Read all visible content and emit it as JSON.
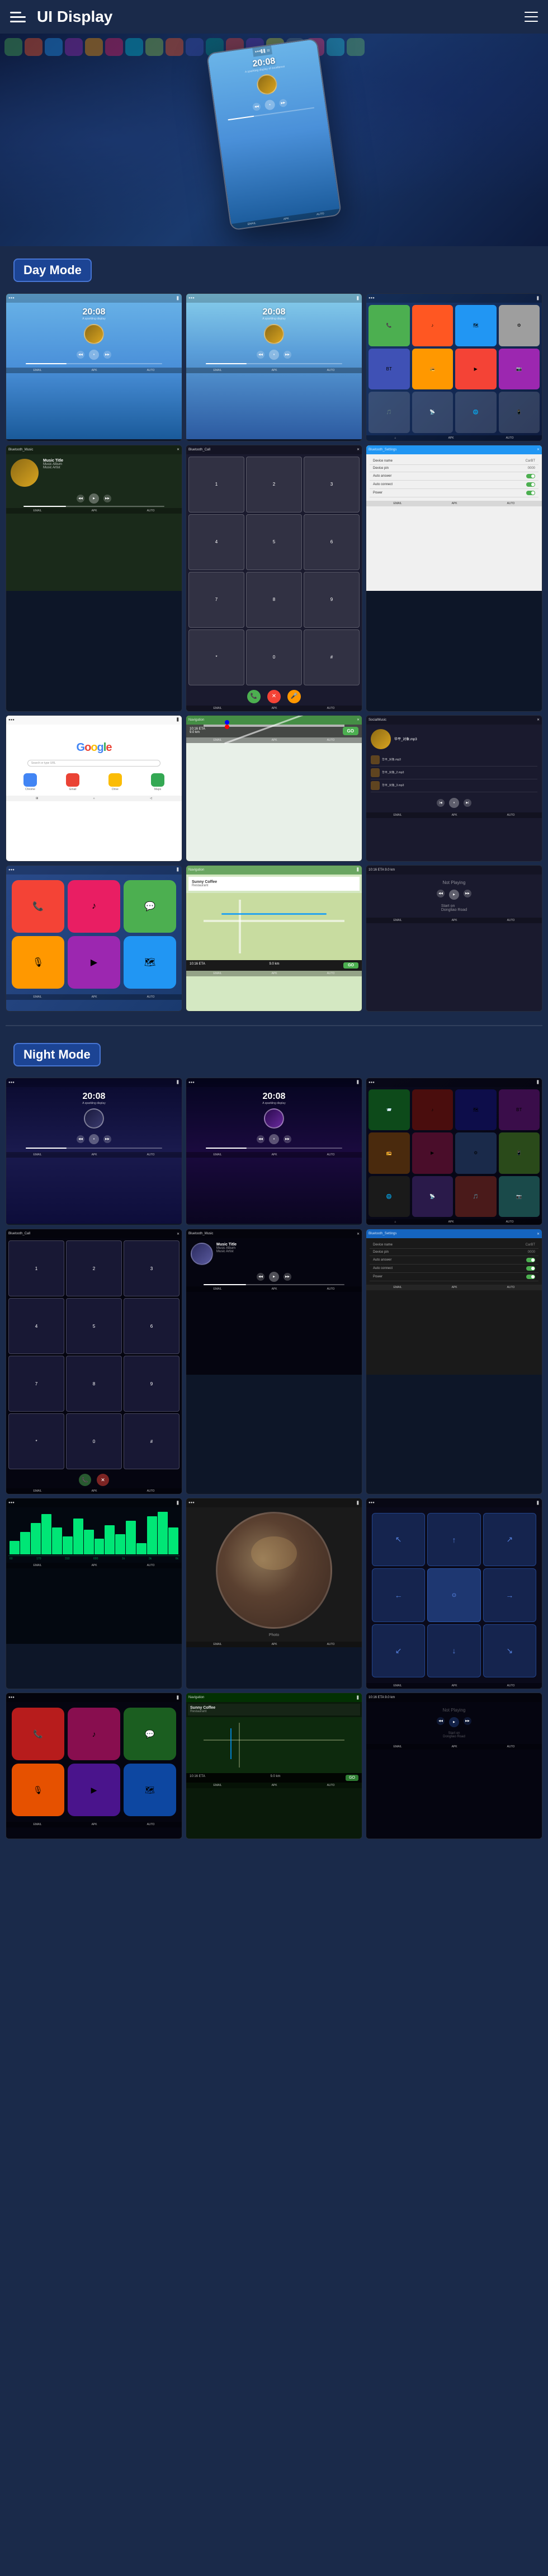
{
  "header": {
    "title": "UI Display",
    "menu_icon": "☰",
    "nav_icon": "≡"
  },
  "sections": {
    "day_mode": {
      "label": "Day Mode"
    },
    "night_mode": {
      "label": "Night Mode"
    }
  },
  "screens": {
    "music_title": "Music Title",
    "music_album": "Music Album",
    "music_artist": "Music Artist",
    "time": "20:08",
    "device_name": "CarBT",
    "device_pin": "0000",
    "auto_answer": "Auto answer",
    "auto_connect": "Auto connect",
    "power": "Power",
    "bluetooth_music": "Bluetooth_Music",
    "bluetooth_call": "Bluetooth_Call",
    "bluetooth_settings": "Bluetooth_Settings",
    "social_music": "SocialMusic",
    "google": "Google",
    "navigation": "Navigation",
    "sunny_coffee": "Sunny Coffee",
    "restaurant": "Restaurant",
    "not_playing": "Not Playing",
    "start_on": "Start on",
    "dongliao": "Dongliao Road",
    "eta": "10:16 ETA",
    "distance": "9.0 km",
    "go": "GO",
    "map_label": "地图/Map"
  }
}
